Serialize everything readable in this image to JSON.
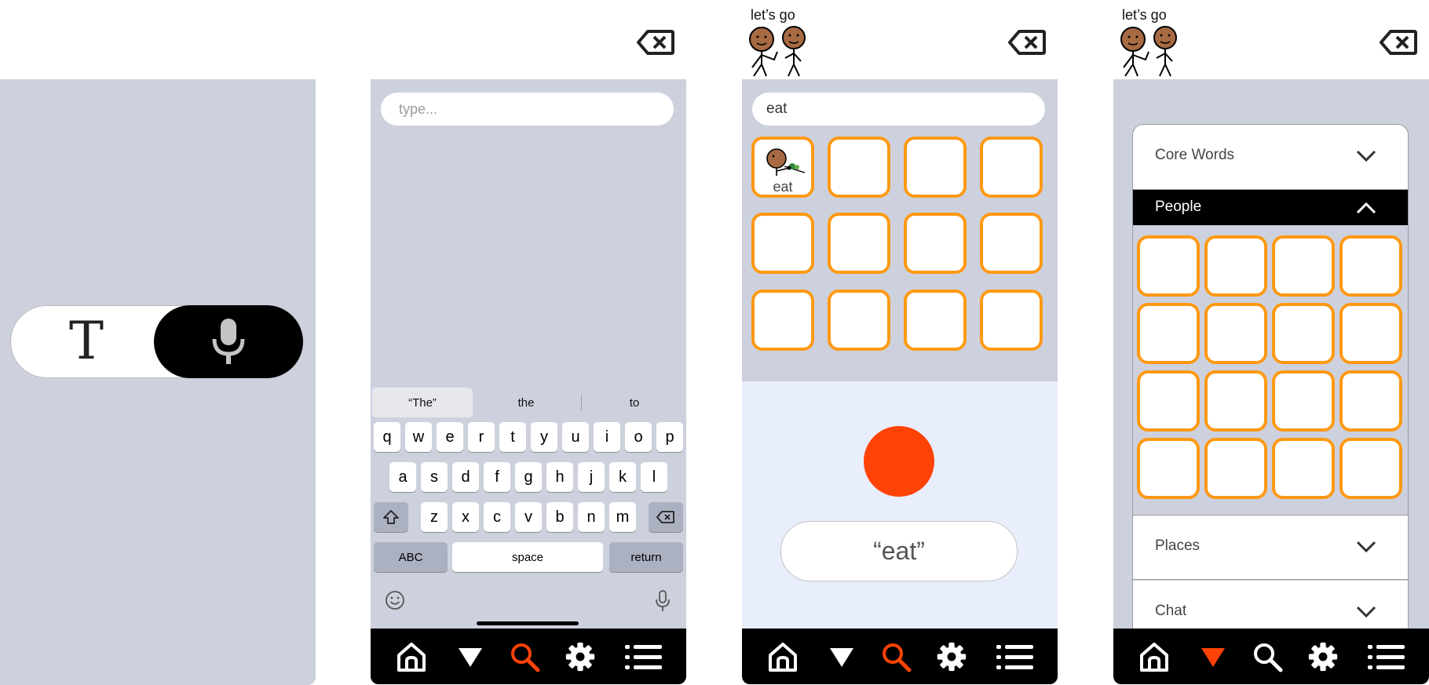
{
  "screen1": {
    "mode_toggle": {
      "text_icon": "T",
      "text_mode_icon": "text-icon",
      "voice_mode_icon": "microphone-icon"
    }
  },
  "screen2": {
    "search": {
      "placeholder": "type...",
      "value": ""
    },
    "suggestions": [
      "“The”",
      "the",
      "to"
    ],
    "keyboard": {
      "row1": [
        "q",
        "w",
        "e",
        "r",
        "t",
        "y",
        "u",
        "i",
        "o",
        "p"
      ],
      "row2": [
        "a",
        "s",
        "d",
        "f",
        "g",
        "h",
        "j",
        "k",
        "l"
      ],
      "row3": [
        "z",
        "x",
        "c",
        "v",
        "b",
        "n",
        "m"
      ],
      "abc": "ABC",
      "space": "space",
      "return": "return"
    }
  },
  "screen3": {
    "header_label": "let’s go",
    "search": {
      "value": "eat"
    },
    "tiles": [
      {
        "label": "eat",
        "icon": "person-eating-icon"
      }
    ],
    "record_button_color": "#ff4307",
    "transcript": "“eat”"
  },
  "screen4": {
    "header_label": "let’s go",
    "categories": [
      {
        "label": "Core Words",
        "expanded": false
      },
      {
        "label": "People",
        "expanded": true
      },
      {
        "label": "Places",
        "expanded": false
      },
      {
        "label": "Chat",
        "expanded": false
      }
    ]
  },
  "nav": {
    "items": [
      "home-icon",
      "filter-icon",
      "search-icon",
      "settings-icon",
      "menu-icon"
    ],
    "screen2_active": "search-icon",
    "screen3_active": "search-icon",
    "screen4_active": "filter-icon"
  },
  "colors": {
    "accent": "#ff4307",
    "tile_border": "#ff9913",
    "panel_bg": "#cdd1de",
    "nav_bg": "#000000"
  }
}
